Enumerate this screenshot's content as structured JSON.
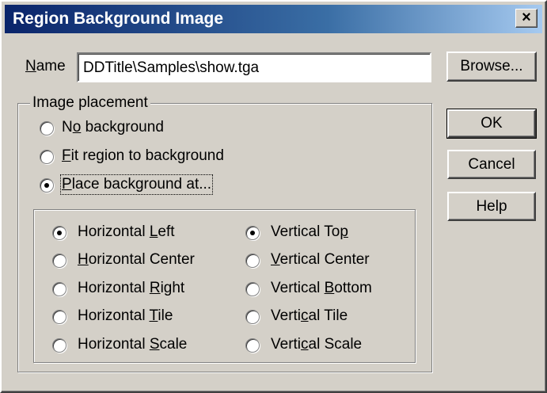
{
  "window": {
    "title": "Region Background Image",
    "close_glyph": "×"
  },
  "name_field": {
    "label_u": "N",
    "label_rest": "ame",
    "value": "DDTitle\\Samples\\show.tga"
  },
  "buttons": {
    "browse": "Browse...",
    "ok": "OK",
    "cancel": "Cancel",
    "help": "Help"
  },
  "image_placement": {
    "legend": "Image placement",
    "selected": "place_background_at",
    "options": {
      "no_background": {
        "pre": "N",
        "u": "o",
        "post": " background",
        "checked": false
      },
      "fit_region": {
        "pre": "",
        "u": "F",
        "post": "it region to background",
        "checked": false
      },
      "place_background_at": {
        "pre": "",
        "u": "P",
        "post": "lace background at...",
        "checked": true
      }
    }
  },
  "horizontal": [
    {
      "pre": "Horizontal ",
      "u": "L",
      "post": "eft",
      "checked": true
    },
    {
      "pre": "",
      "u": "H",
      "post": "orizontal Center",
      "checked": false
    },
    {
      "pre": "Horizontal ",
      "u": "R",
      "post": "ight",
      "checked": false
    },
    {
      "pre": "Horizontal ",
      "u": "T",
      "post": "ile",
      "checked": false
    },
    {
      "pre": "Horizontal ",
      "u": "S",
      "post": "cale",
      "checked": false
    }
  ],
  "vertical": [
    {
      "pre": "Vertical To",
      "u": "p",
      "post": "",
      "checked": true
    },
    {
      "pre": "",
      "u": "V",
      "post": "ertical Center",
      "checked": false
    },
    {
      "pre": "Vertical ",
      "u": "B",
      "post": "ottom",
      "checked": false
    },
    {
      "pre": "Verti",
      "u": "c",
      "post": "al Tile",
      "checked": false
    },
    {
      "pre": "Verti",
      "u": "c",
      "post": "al Scale",
      "checked": false
    }
  ]
}
